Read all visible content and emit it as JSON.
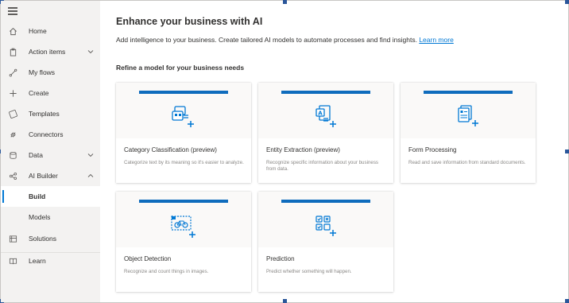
{
  "sidebar": {
    "items": [
      {
        "label": "Home"
      },
      {
        "label": "Action items"
      },
      {
        "label": "My flows"
      },
      {
        "label": "Create"
      },
      {
        "label": "Templates"
      },
      {
        "label": "Connectors"
      },
      {
        "label": "Data"
      },
      {
        "label": "AI Builder"
      },
      {
        "label": "Build"
      },
      {
        "label": "Models"
      },
      {
        "label": "Solutions"
      },
      {
        "label": "Learn"
      }
    ]
  },
  "main": {
    "title": "Enhance your business with AI",
    "subtitle": "Add intelligence to your business. Create tailored AI models to automate processes and find insights.",
    "learn_more": "Learn more",
    "section_title": "Refine a model for your business needs",
    "cards": [
      {
        "name": "Category Classification (preview)",
        "desc": "Categorize text by its meaning so it's easier to analyze."
      },
      {
        "name": "Entity Extraction (preview)",
        "desc": "Recognize specific information about your business from data."
      },
      {
        "name": "Form Processing",
        "desc": "Read and save information from standard documents."
      },
      {
        "name": "Object Detection",
        "desc": "Recognize and count things in images."
      },
      {
        "name": "Prediction",
        "desc": "Predict whether something will happen."
      }
    ]
  },
  "colors": {
    "accent": "#0078d4",
    "card_bar": "#0f6cbd",
    "sidebar_bg": "#f3f2f1"
  }
}
